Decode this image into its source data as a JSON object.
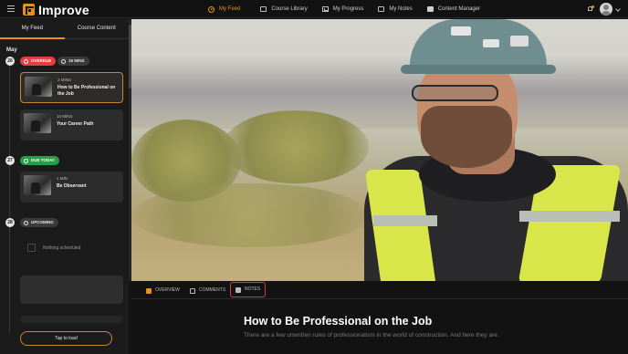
{
  "app": {
    "name": "Improve"
  },
  "nav": {
    "items": [
      {
        "label": "My Feed",
        "icon": "play-circle-icon",
        "active": true
      },
      {
        "label": "Course Library",
        "icon": "library-icon",
        "active": false
      },
      {
        "label": "My Progress",
        "icon": "progress-icon",
        "active": false
      },
      {
        "label": "My Notes",
        "icon": "notes-icon",
        "active": false
      },
      {
        "label": "Content Manager",
        "icon": "folder-icon",
        "active": false
      }
    ]
  },
  "sidebar": {
    "tabs": [
      {
        "label": "My Feed"
      },
      {
        "label": "Course Content"
      }
    ],
    "month": "May",
    "days": [
      {
        "day": "26",
        "badges": [
          {
            "label": "OVERDUE",
            "color": "#e24040"
          },
          {
            "label": "15 MINS",
            "color": "#3b3b3b"
          }
        ],
        "cards": [
          {
            "duration": "2 MINS",
            "title": "How to Be Professional on the Job",
            "active": true
          },
          {
            "duration": "10 MINS",
            "title": "Your Career Path",
            "active": false
          }
        ]
      },
      {
        "day": "27",
        "badges": [
          {
            "label": "DUE TODAY",
            "color": "#24a048"
          }
        ],
        "cards": [
          {
            "duration": "1 MIN",
            "title": "Be Observant",
            "active": false
          }
        ]
      },
      {
        "day": "28",
        "badges": [
          {
            "label": "UPCOMING",
            "color": "#3b3b3b"
          }
        ],
        "empty_text": "Nothing scheduled"
      }
    ],
    "load_button": "Tap to load"
  },
  "content_tabs": [
    {
      "label": "OVERVIEW",
      "icon": "overview-icon"
    },
    {
      "label": "COMMENTS",
      "icon": "comments-icon"
    },
    {
      "label": "NOTES",
      "icon": "notes-icon",
      "highlighted": true
    }
  ],
  "course": {
    "title": "How to Be Professional on the Job",
    "description": "There are a few unwritten rules of professionalism in the world of construction. And here they are."
  },
  "colors": {
    "accent": "#e8901a",
    "overdue": "#e24040",
    "due_today": "#24a048",
    "highlight": "#d33d30"
  }
}
